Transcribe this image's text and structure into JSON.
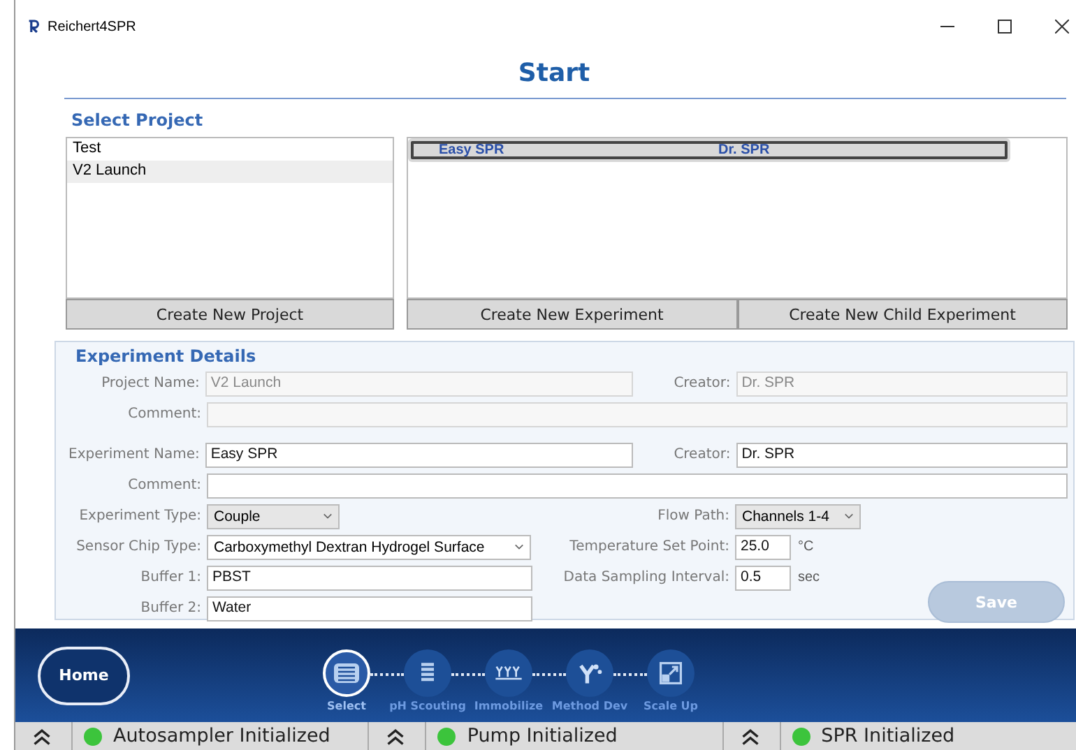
{
  "window": {
    "title": "Reichert4SPR"
  },
  "heading": "Start",
  "select_project": {
    "title": "Select Project",
    "projects": [
      {
        "name": "Test",
        "selected": false
      },
      {
        "name": "V2 Launch",
        "selected": true
      }
    ],
    "create_project": "Create New Project",
    "experiments": [
      {
        "name": "Easy SPR",
        "creator": "Dr. SPR",
        "selected": true
      }
    ],
    "create_experiment": "Create New Experiment",
    "create_child": "Create New Child Experiment"
  },
  "details": {
    "title": "Experiment Details",
    "project_name": {
      "label": "Project Name:",
      "value": "V2 Launch",
      "disabled": true
    },
    "project_creator": {
      "label": "Creator:",
      "value": "Dr. SPR",
      "disabled": true
    },
    "project_comment": {
      "label": "Comment:",
      "disabled": true
    },
    "experiment_name": {
      "label": "Experiment Name:",
      "value": "Easy SPR",
      "disabled": false
    },
    "experiment_creator": {
      "label": "Creator:",
      "value": "Dr. SPR",
      "disabled": false
    },
    "experiment_comment": {
      "label": "Comment:",
      "disabled": false
    },
    "experiment_type": {
      "label": "Experiment Type:",
      "value": "Couple"
    },
    "sensor_chip": {
      "label": "Sensor Chip Type:",
      "value": "Carboxymethyl Dextran Hydrogel Surface"
    },
    "buffer_1": {
      "label": "Buffer 1:",
      "value": "PBST"
    },
    "buffer_2": {
      "label": "Buffer 2:",
      "value": "Water"
    },
    "flow_path": {
      "label": "Flow Path:",
      "value": "Channels 1-4"
    },
    "temperature": {
      "label": "Temperature Set Point:",
      "value": "25.0",
      "unit": "°C"
    },
    "sampling": {
      "label": "Data Sampling Interval:",
      "value": "0.5",
      "unit": "sec"
    },
    "save": {
      "label": "Save",
      "disabled": true
    }
  },
  "nav": {
    "home": "Home",
    "steps": [
      {
        "label": "Select",
        "kind": "list",
        "selected": true
      },
      {
        "label": "pH Scouting",
        "kind": "bars",
        "selected": false
      },
      {
        "label": "Immobilize",
        "kind": "yyy",
        "selected": false
      },
      {
        "label": "Method Dev",
        "kind": "molecule",
        "selected": false
      },
      {
        "label": "Scale Up",
        "kind": "scale",
        "selected": false
      }
    ]
  },
  "status_bar": [
    {
      "label": "Autosampler Initialized",
      "color": "#3cc43c"
    },
    {
      "label": "Pump Initialized",
      "color": "#3cc43c"
    },
    {
      "label": "SPR Initialized",
      "color": "#3cc43c"
    }
  ]
}
